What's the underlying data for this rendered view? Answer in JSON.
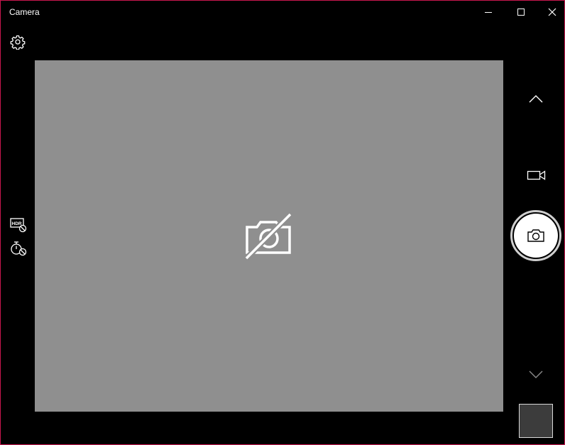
{
  "window": {
    "title": "Camera"
  },
  "icons": {
    "minimize": "minimize-icon",
    "maximize": "maximize-icon",
    "close": "close-icon",
    "settings": "gear-icon",
    "hdr": "hdr-off-icon",
    "timer": "timer-off-icon",
    "preview_status": "camera-unavailable-icon",
    "scroll_up": "chevron-up-icon",
    "video_mode": "video-camera-icon",
    "photo_mode": "camera-icon",
    "scroll_down": "chevron-down-icon"
  },
  "colors": {
    "window_border": "#c8174e",
    "preview_bg": "#8f8f8f",
    "background": "#000000"
  }
}
